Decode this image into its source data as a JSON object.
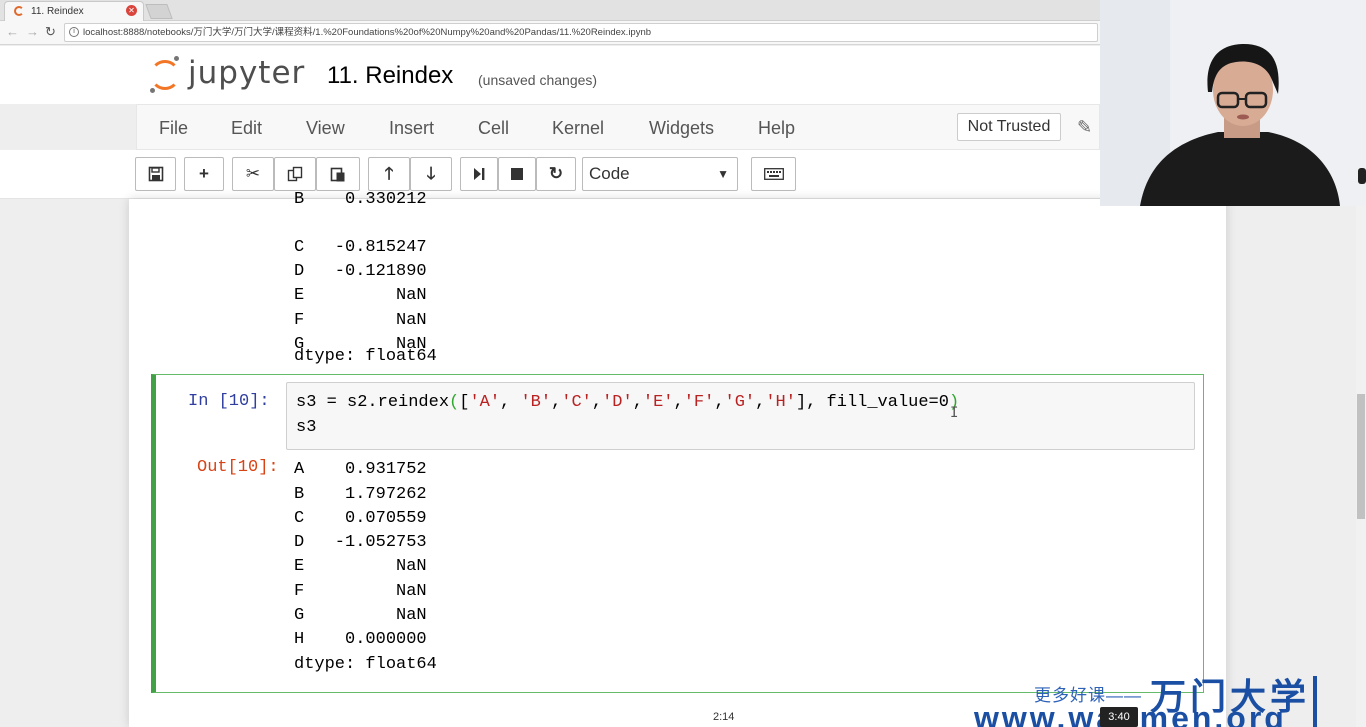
{
  "browser": {
    "tab_title": "11. Reindex",
    "url": "localhost:8888/notebooks/万门大学/万门大学/课程资料/1.%20Foundations%20of%20Numpy%20and%20Pandas/11.%20Reindex.ipynb"
  },
  "header": {
    "brand": "jupyter",
    "notebook_title": "11. Reindex",
    "status": "(unsaved changes)"
  },
  "menubar": {
    "items": [
      "File",
      "Edit",
      "View",
      "Insert",
      "Cell",
      "Kernel",
      "Widgets",
      "Help"
    ],
    "trust_label": "Not Trusted"
  },
  "toolbar": {
    "cell_type": "Code"
  },
  "notebook": {
    "prev_output": [
      "B    0.330212",
      "C   -0.815247",
      "D   -0.121890",
      "E         NaN",
      "F         NaN",
      "G         NaN",
      "dtype: float64"
    ],
    "cell": {
      "in_prompt": "In  [10]:",
      "out_prompt": "Out[10]:",
      "code_line1_a": "s3 = s2.reindex",
      "code_line1_open": "(",
      "code_line1_list_open": "[",
      "code_tokens": [
        "'A'",
        ", ",
        "'B'",
        ",",
        "'C'",
        ",",
        "'D'",
        ",",
        "'E'",
        ",",
        "'F'",
        ",",
        "'G'",
        ",",
        "'H'"
      ],
      "code_line1_tail": "], fill_value=0",
      "code_line1_close": ")",
      "code_line2": "s3",
      "output": [
        "A    0.931752",
        "B    1.797262",
        "C    0.070559",
        "D   -1.052753",
        "E         NaN",
        "F         NaN",
        "G         NaN",
        "H    0.000000",
        "dtype: float64"
      ]
    }
  },
  "overlay": {
    "watermark_small": "更多好课——",
    "watermark_big": "万门大学",
    "watermark_url": "www.wanmen.org",
    "video_time": "2:14",
    "video_duration": "3:40"
  },
  "colors": {
    "jupyter_orange": "#f37626",
    "cell_border_green": "#42a047",
    "in_prompt_blue": "#303f9f",
    "out_prompt_red": "#d84315",
    "string_red": "#ba2121"
  }
}
